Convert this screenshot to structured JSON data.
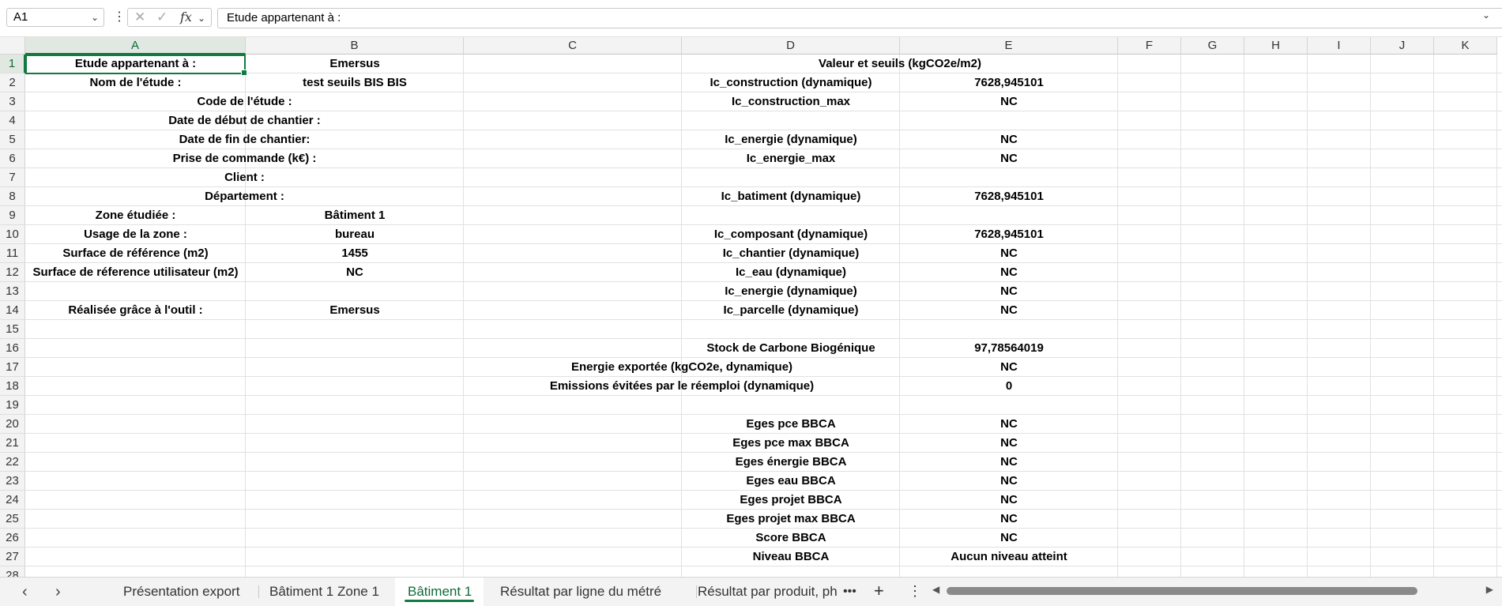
{
  "formula_bar": {
    "name_box": "A1",
    "formula": "Etude appartenant à :"
  },
  "columns": [
    "A",
    "B",
    "C",
    "D",
    "E",
    "F",
    "G",
    "H",
    "I",
    "J",
    "K"
  ],
  "rows": [
    "1",
    "2",
    "3",
    "4",
    "5",
    "6",
    "7",
    "8",
    "9",
    "10",
    "11",
    "12",
    "13",
    "14",
    "15",
    "16",
    "17",
    "18",
    "19",
    "20",
    "21",
    "22",
    "23",
    "24",
    "25",
    "26",
    "27",
    "28"
  ],
  "cells": {
    "A1": "Etude appartenant à :",
    "B1": "Emersus",
    "D1": "Valeur et seuils (kgCO2e/m2)",
    "A2": "Nom de l'étude :",
    "B2": "test seuils BIS BIS",
    "D2": "Ic_construction (dynamique)",
    "E2": "7628,945101",
    "A3": "Code de l'étude :",
    "D3": "Ic_construction_max",
    "E3": "NC",
    "A4": "Date de début de chantier :",
    "A5": "Date de fin de chantier:",
    "D5": "Ic_energie (dynamique)",
    "E5": "NC",
    "A6": "Prise de commande (k€) :",
    "D6": "Ic_energie_max",
    "E6": "NC",
    "A7": "Client :",
    "A8": "Département :",
    "D8": "Ic_batiment (dynamique)",
    "E8": "7628,945101",
    "A9": "Zone étudiée :",
    "B9": "Bâtiment 1",
    "A10": "Usage de la zone :",
    "B10": "bureau",
    "D10": "Ic_composant (dynamique)",
    "E10": "7628,945101",
    "A11": "Surface de référence (m2)",
    "B11": "1455",
    "D11": "Ic_chantier (dynamique)",
    "E11": "NC",
    "A12": "Surface de réference utilisateur (m2)",
    "B12": "NC",
    "D12": "Ic_eau (dynamique)",
    "E12": "NC",
    "D13": "Ic_energie (dynamique)",
    "E13": "NC",
    "A14": "Réalisée grâce à l'outil :",
    "B14": "Emersus",
    "D14": "Ic_parcelle (dynamique)",
    "E14": "NC",
    "D16": "Stock de Carbone Biogénique",
    "E16": "97,78564019",
    "D17": "Energie exportée (kgCO2e, dynamique)",
    "E17": "NC",
    "D18": "Emissions évitées par le réemploi (dynamique)",
    "E18": "0",
    "D20": "Eges pce BBCA",
    "E20": "NC",
    "D21": "Eges pce max BBCA",
    "E21": "NC",
    "D22": "Eges énergie BBCA",
    "E22": "NC",
    "D23": "Eges eau BBCA",
    "E23": "NC",
    "D24": "Eges projet BBCA",
    "E24": "NC",
    "D25": "Eges projet max BBCA",
    "E25": "NC",
    "D26": "Score BBCA",
    "E26": "NC",
    "D27": "Niveau BBCA",
    "E27": "Aucun niveau atteint"
  },
  "sheet_tabs": [
    "Présentation export",
    "Bâtiment 1 Zone 1",
    "Bâtiment 1",
    "Résultat par ligne du métré",
    "Résultat par produit, ph"
  ],
  "active_tab": "Bâtiment 1",
  "colors": {
    "accent": "#127a41",
    "accent_text": "#0f6b38",
    "header_bg": "#f3f3f3",
    "grid": "#e1e1e1"
  }
}
